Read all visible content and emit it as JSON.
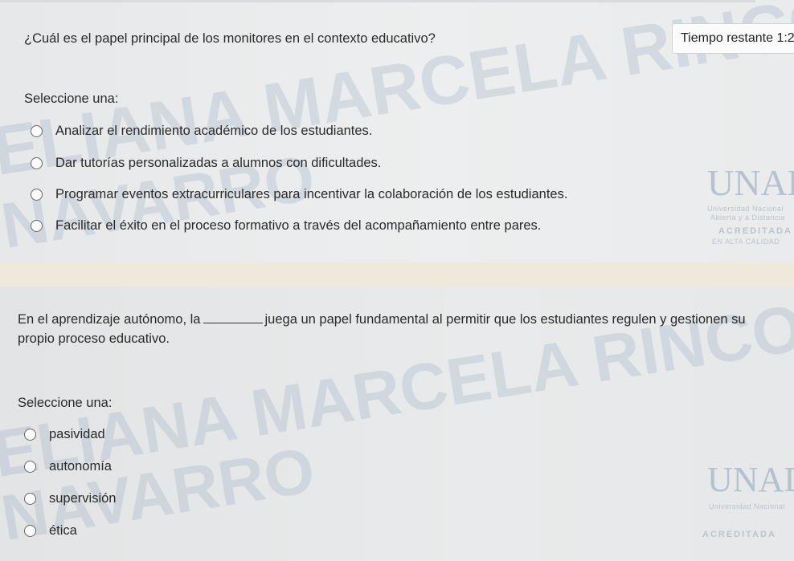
{
  "timer": {
    "label": "Tiempo restante 1:2"
  },
  "question1": {
    "text": "¿Cuál es el papel principal de los monitores en el contexto educativo?",
    "select_label": "Seleccione una:",
    "options": [
      "Analizar el rendimiento académico de los estudiantes.",
      "Dar tutorías personalizadas a alumnos con dificultades.",
      "Programar eventos extracurriculares para incentivar la colaboración de los estudiantes.",
      "Facilitar el éxito en el proceso formativo a través del acompañamiento entre pares."
    ]
  },
  "question2": {
    "text_before": "En el aprendizaje autónomo, la",
    "text_after": "juega un papel fundamental al permitir que los estudiantes regulen y gestionen su",
    "text_line2": "propio proceso educativo.",
    "select_label": "Seleccione una:",
    "options": [
      "pasividad",
      "autonomía",
      "supervisión",
      "ética"
    ]
  },
  "watermark": {
    "name_a": "ELIANA MARCELA RINCON",
    "name_b": "NAVARRO",
    "name_c": "ELIANA MARCELA RINCON",
    "name_d": "NAVARRO"
  },
  "logo": {
    "mark_1": "UNAD",
    "university_1": "Universidad Nacional",
    "sub_1": "Abierta y a Distancia",
    "accr_1": "ACREDITADA",
    "accr_sub_1": "EN ALTA CALIDAD",
    "mark_2": "UNAD",
    "university_2": "Universidad Nacional",
    "accr_2": "ACREDITADA"
  }
}
